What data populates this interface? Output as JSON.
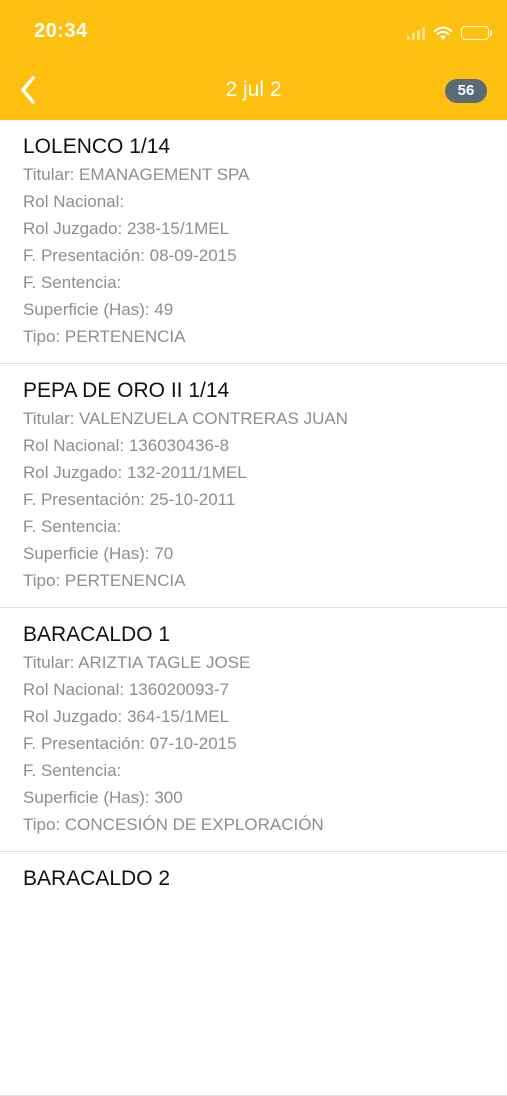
{
  "status_bar": {
    "time": "20:34"
  },
  "nav": {
    "title": "2 jul 2",
    "badge_count": "56",
    "back_icon": "chevron-left-icon"
  },
  "colors": {
    "header": "#FDC010",
    "badge": "#5A6B78"
  },
  "records": [
    {
      "name": "LOLENCO 1/14",
      "titular": "Titular: EMANAGEMENT SPA",
      "rol_nacional": "Rol Nacional:",
      "rol_juzgado": "Rol Juzgado: 238-15/1MEL",
      "f_presentacion": "F. Presentación: 08-09-2015",
      "f_sentencia": "F. Sentencia:",
      "superficie": "Superficie (Has): 49",
      "tipo": "Tipo: PERTENENCIA"
    },
    {
      "name": "PEPA DE ORO II 1/14",
      "titular": "Titular: VALENZUELA CONTRERAS JUAN",
      "rol_nacional": "Rol Nacional: 136030436-8",
      "rol_juzgado": "Rol Juzgado: 132-2011/1MEL",
      "f_presentacion": "F. Presentación: 25-10-2011",
      "f_sentencia": "F. Sentencia:",
      "superficie": "Superficie (Has): 70",
      "tipo": "Tipo: PERTENENCIA"
    },
    {
      "name": "BARACALDO 1",
      "titular": "Titular: ARIZTIA TAGLE JOSE",
      "rol_nacional": "Rol Nacional: 136020093-7",
      "rol_juzgado": "Rol Juzgado: 364-15/1MEL",
      "f_presentacion": "F. Presentación: 07-10-2015",
      "f_sentencia": "F. Sentencia:",
      "superficie": "Superficie (Has): 300",
      "tipo": "Tipo: CONCESIÓN DE EXPLORACIÓN"
    },
    {
      "name": "BARACALDO 2"
    }
  ]
}
